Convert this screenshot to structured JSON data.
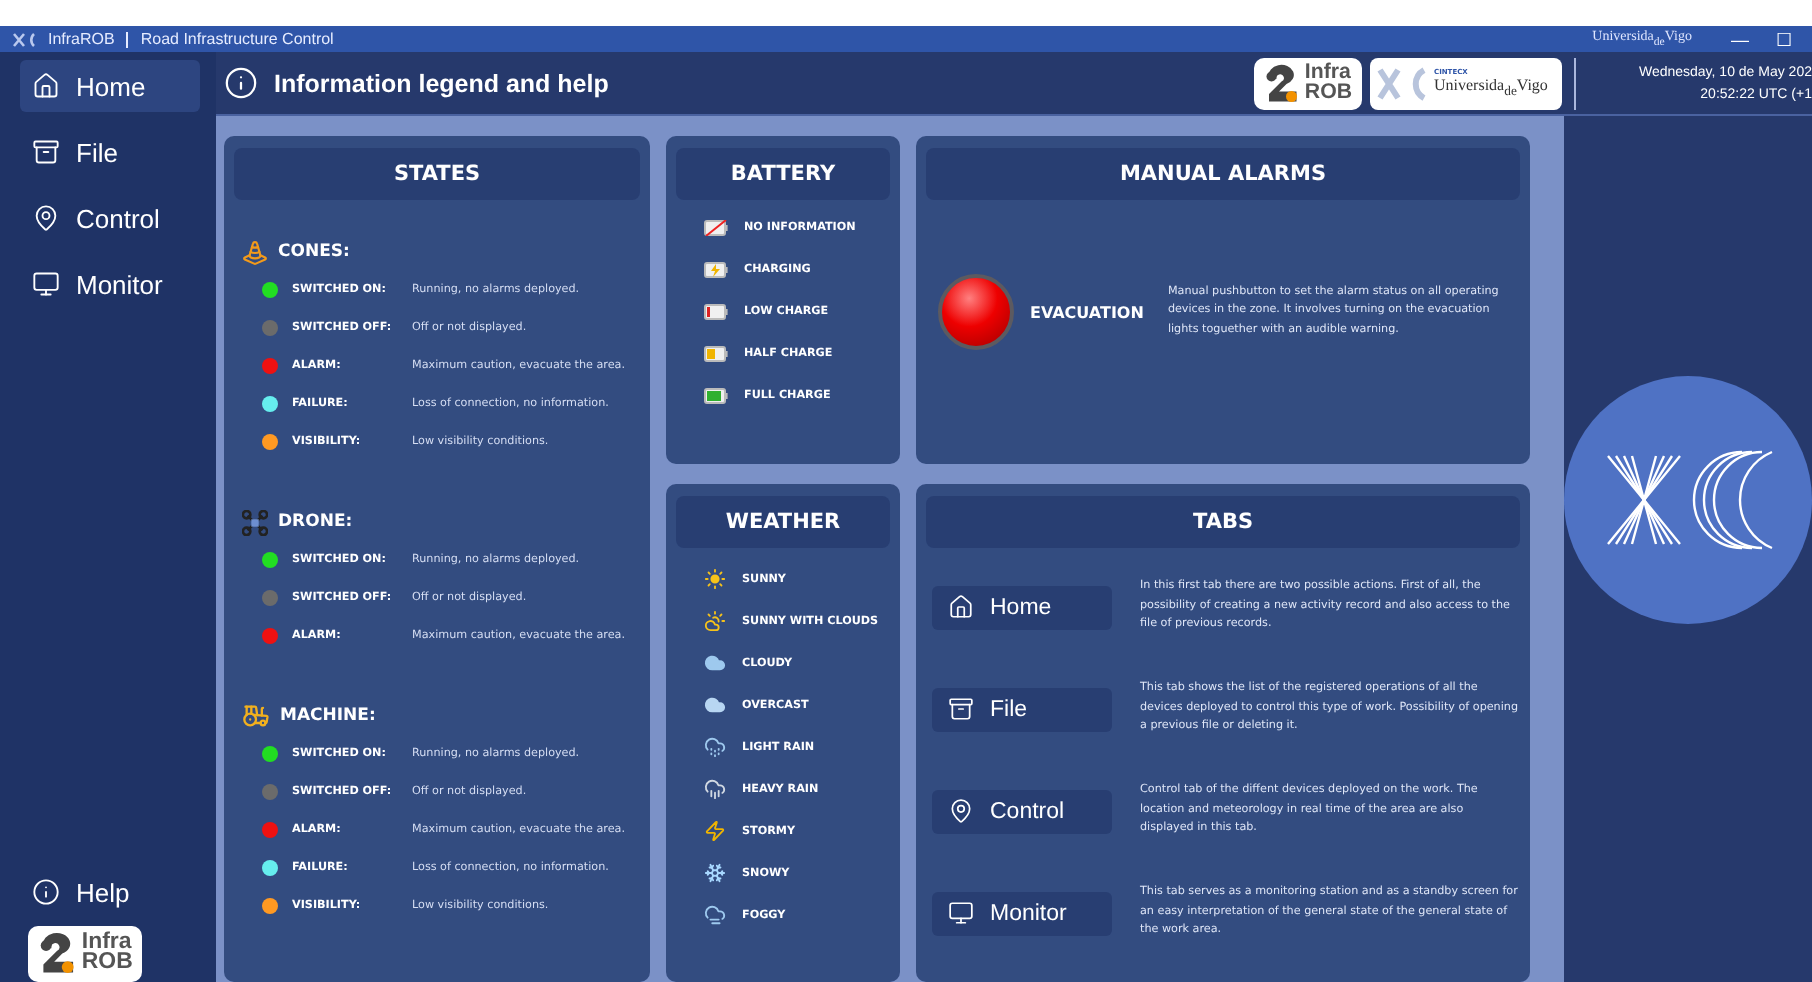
{
  "window": {
    "app_name": "InfraROB",
    "subtitle": "Road Infrastructure Control",
    "brand": "Universida$_{de}$Vigo",
    "controls": [
      "—",
      "☐"
    ]
  },
  "sidebar": {
    "items": [
      {
        "label": "Home",
        "kind": "home",
        "selected": true
      },
      {
        "label": "File",
        "kind": "file",
        "selected": false
      },
      {
        "label": "Control",
        "kind": "control",
        "selected": false
      },
      {
        "label": "Monitor",
        "kind": "monitor",
        "selected": false
      }
    ],
    "help": "Help",
    "logo": {
      "line_1": "Infra",
      "line_2": "ROB"
    }
  },
  "header": {
    "title": "Information legend and help",
    "logo": {
      "line_1": "Infra",
      "line_2": "ROB"
    },
    "partner_logo": {
      "small": "CINTECX",
      "name": "Universida$_{de}$Vigo"
    },
    "date": "Wednesday, 10 de May 202",
    "time": "20:52:22  UTC (+1"
  },
  "states": {
    "title": "STATES",
    "groups": [
      {
        "name": "CONES:",
        "kind": "cone",
        "items": [
          {
            "label": "SWITCHED ON:",
            "text": "Running, no alarms deployed.",
            "color": "#22dd22"
          },
          {
            "label": "SWITCHED OFF:",
            "text": "Off or not displayed.",
            "color": "#6b6b6b"
          },
          {
            "label": "ALARM:",
            "text": "Maximum caution, evacuate the area.",
            "color": "#ee1111"
          },
          {
            "label": "FAILURE:",
            "text": "Loss of connection, no information.",
            "color": "#66eeee"
          },
          {
            "label": "VISIBILITY:",
            "text": "Low visibility conditions.",
            "color": "#ff9922"
          }
        ]
      },
      {
        "name": "DRONE:",
        "kind": "drone",
        "items": [
          {
            "label": "SWITCHED ON:",
            "text": "Running, no alarms deployed.",
            "color": "#22dd22"
          },
          {
            "label": "SWITCHED OFF:",
            "text": "Off or not displayed.",
            "color": "#6b6b6b"
          },
          {
            "label": "ALARM:",
            "text": "Maximum caution, evacuate the area.",
            "color": "#ee1111"
          }
        ]
      },
      {
        "name": "MACHINE:",
        "kind": "machine",
        "items": [
          {
            "label": "SWITCHED ON:",
            "text": "Running, no alarms deployed.",
            "color": "#22dd22"
          },
          {
            "label": "SWITCHED OFF:",
            "text": "Off or not displayed.",
            "color": "#6b6b6b"
          },
          {
            "label": "ALARM:",
            "text": "Maximum caution, evacuate the area.",
            "color": "#ee1111"
          },
          {
            "label": "FAILURE:",
            "text": "Loss of connection, no information.",
            "color": "#66eeee"
          },
          {
            "label": "VISIBILITY:",
            "text": "Low visibility conditions.",
            "color": "#ff9922"
          }
        ]
      }
    ]
  },
  "battery": {
    "title": "BATTERY",
    "items": [
      {
        "label": "NO INFORMATION",
        "kind": "none"
      },
      {
        "label": "CHARGING",
        "kind": "charging"
      },
      {
        "label": "LOW CHARGE",
        "kind": "low"
      },
      {
        "label": "HALF CHARGE",
        "kind": "half"
      },
      {
        "label": "FULL CHARGE",
        "kind": "full"
      }
    ]
  },
  "weather": {
    "title": "WEATHER",
    "items": [
      {
        "label": "SUNNY",
        "kind": "sunny"
      },
      {
        "label": "SUNNY WITH CLOUDS",
        "kind": "partly"
      },
      {
        "label": "CLOUDY",
        "kind": "cloudy"
      },
      {
        "label": "OVERCAST",
        "kind": "overcast"
      },
      {
        "label": "LIGHT RAIN",
        "kind": "lightrain"
      },
      {
        "label": "HEAVY RAIN",
        "kind": "heavyrain"
      },
      {
        "label": "STORMY",
        "kind": "stormy"
      },
      {
        "label": "SNOWY",
        "kind": "snowy"
      },
      {
        "label": "FOGGY",
        "kind": "foggy"
      }
    ]
  },
  "manual_alarms": {
    "title": "MANUAL ALARMS",
    "button": "EVACUATION",
    "text": "Manual pushbutton to set the alarm status on all operating devices in the zone. It involves turning on the evacuation lights toguether with an audible warning."
  },
  "tabs": {
    "title": "TABS",
    "items": [
      {
        "label": "Home",
        "kind": "home",
        "text": "In this first tab there are two possible actions. First of all, the possibility of creating a new activity record and also access to the file of previous records."
      },
      {
        "label": "File",
        "kind": "file",
        "text": "This tab shows the list of the registered operations of all the devices deployed to control this type of work. Possibility of opening a previous file or deleting it."
      },
      {
        "label": "Control",
        "kind": "control",
        "text": "Control tab of the diffent devices deployed on the work. The location and meteorology in real time of the area are also displayed in this tab."
      },
      {
        "label": "Monitor",
        "kind": "monitor",
        "text": "This tab serves as a monitoring station and as a standby screen for an easy interpretation of the general state of the general state of the work area."
      }
    ]
  }
}
